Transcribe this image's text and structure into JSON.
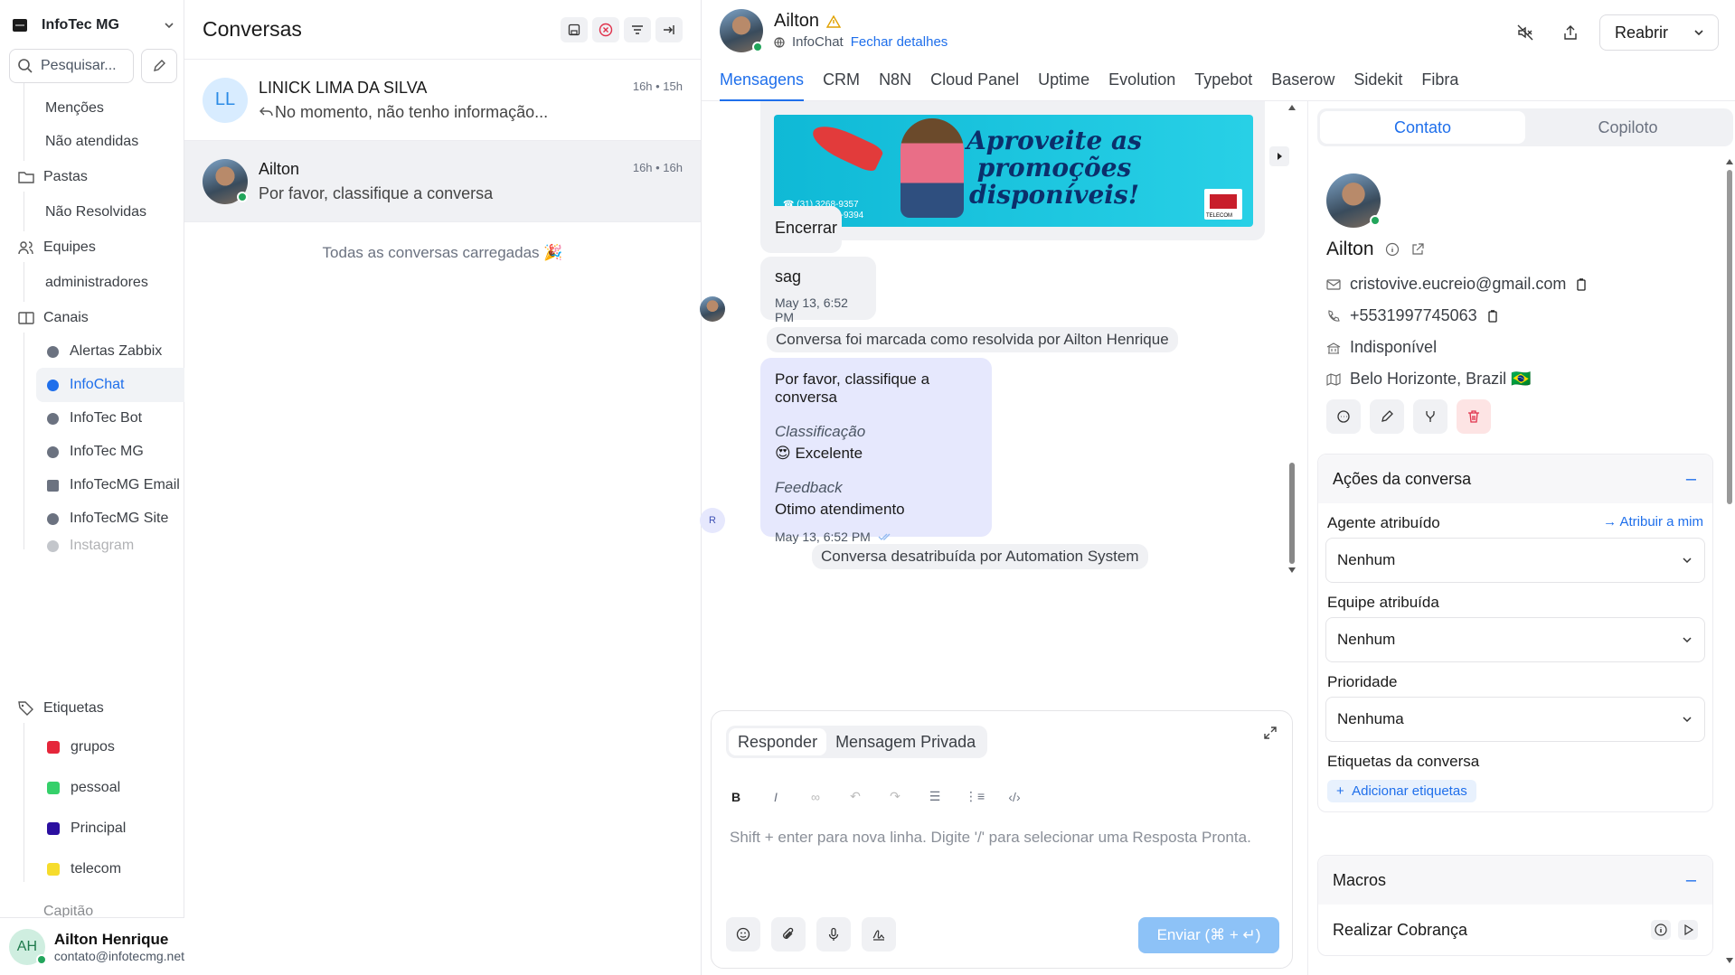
{
  "workspace": {
    "name": "InfoTec MG"
  },
  "sidebar": {
    "search_placeholder": "Pesquisar...",
    "items": [
      {
        "label": "Menções"
      },
      {
        "label": "Não atendidas"
      }
    ],
    "folders": {
      "label": "Pastas",
      "items": [
        {
          "label": "Não Resolvidas"
        }
      ]
    },
    "teams": {
      "label": "Equipes",
      "items": [
        {
          "label": "administradores"
        }
      ]
    },
    "channels": {
      "label": "Canais",
      "items": [
        {
          "label": "Alertas Zabbix"
        },
        {
          "label": "InfoChat"
        },
        {
          "label": "InfoTec Bot"
        },
        {
          "label": "InfoTec MG"
        },
        {
          "label": "InfoTecMG Email"
        },
        {
          "label": "InfoTecMG Site"
        },
        {
          "label": "Instagram"
        }
      ]
    },
    "labels": {
      "label": "Etiquetas",
      "items": [
        {
          "label": "grupos",
          "color": "#e5263a"
        },
        {
          "label": "pessoal",
          "color": "#35d06a"
        },
        {
          "label": "Principal",
          "color": "#2b0fa0"
        },
        {
          "label": "telecom",
          "color": "#f6dc2c"
        }
      ]
    },
    "more": "Capitão",
    "user": {
      "initials": "AH",
      "name": "Ailton Henrique",
      "email": "contato@infotecmg.net"
    }
  },
  "conversations": {
    "title": "Conversas",
    "items": [
      {
        "initials": "LL",
        "name": "LINICK LIMA DA SILVA",
        "preview": "No momento, não tenho informação...",
        "time": "16h • 15h"
      },
      {
        "initials": "",
        "name": "Ailton",
        "preview": "Por favor, classifique a conversa",
        "time": "16h • 16h"
      }
    ],
    "all_loaded": "Todas as conversas carregadas 🎉"
  },
  "chat": {
    "contact_name": "Ailton",
    "inbox": "InfoChat",
    "close_details": "Fechar detalhes",
    "reopen": "Reabrir",
    "tabs": [
      "Mensagens",
      "CRM",
      "N8N",
      "Cloud Panel",
      "Uptime",
      "Evolution",
      "Typebot",
      "Baserow",
      "Sidekit",
      "Fibra"
    ],
    "banner": {
      "line1": "Aproveite as",
      "line2": "promoções",
      "line3": "disponíveis!",
      "phone1": "☎ (31) 3268-9357",
      "phone2": "☏ (31) 99487-9394",
      "brand": "TELECOM"
    },
    "messages": {
      "encerrar": "Encerrar",
      "sag": "sag",
      "sag_time": "May 13, 6:52 PM",
      "resolved": "Conversa foi marcada como resolvida por Ailton Henrique",
      "rating_title": "Por favor, classifique a conversa",
      "rating_label": "Classificação",
      "rating_value": "😍 Excelente",
      "feedback_label": "Feedback",
      "feedback_value": "Otimo atendimento",
      "rating_time": "May 13, 6:52 PM",
      "bot_initial": "R",
      "unassigned": "Conversa desatribuída por Automation System"
    }
  },
  "composer": {
    "reply": "Responder",
    "private": "Mensagem Privada",
    "placeholder": "Shift + enter para nova linha. Digite '/' para selecionar uma Resposta Pronta.",
    "send": "Enviar (⌘ + ↵)"
  },
  "contact_panel": {
    "tab_contact": "Contato",
    "tab_copilot": "Copiloto",
    "name": "Ailton",
    "email": "cristovive.eucreio@gmail.com",
    "phone": "+5531997745063",
    "company": "Indisponível",
    "location": "Belo Horizonte, Brazil 🇧🇷",
    "actions_title": "Ações da conversa",
    "agent_label": "Agente atribuído",
    "assign_me": "Atribuir a mim",
    "agent_value": "Nenhum",
    "team_label": "Equipe atribuída",
    "team_value": "Nenhum",
    "priority_label": "Prioridade",
    "priority_value": "Nenhuma",
    "labels_label": "Etiquetas da conversa",
    "add_labels": "Adicionar etiquetas",
    "macros_title": "Macros",
    "macro_name": "Realizar Cobrança"
  }
}
